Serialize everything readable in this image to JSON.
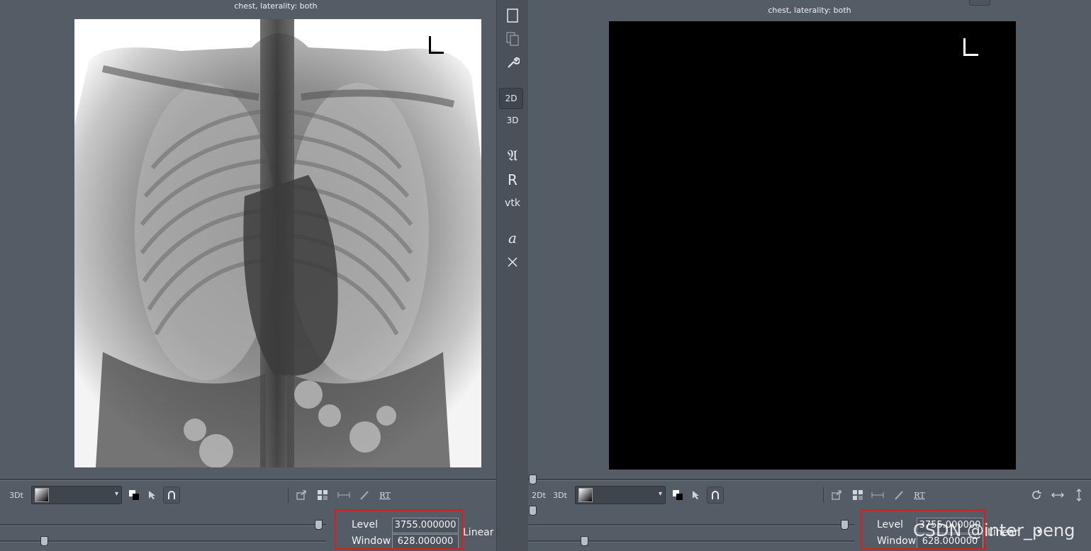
{
  "left_view": {
    "caption": "chest, laterality: both",
    "orientation_marker": "L",
    "toolbar": {
      "mode_3dt": "3Dt"
    },
    "level_label": "Level",
    "level_value": "3755.000000",
    "window_label": "Window",
    "window_value": "628.000000",
    "interpolation": "Linear"
  },
  "right_view": {
    "caption": "chest, laterality: both",
    "orientation_marker": "L",
    "toolbar": {
      "mode_2dt": "2Dt",
      "mode_3dt": "3Dt"
    },
    "level_label": "Level",
    "level_value": "3755.000000",
    "window_label": "Window",
    "window_value": "628.000000",
    "interpolation": "Linear"
  },
  "vertical_toolbar": {
    "mode_2d": "2D",
    "mode_3d": "3D",
    "renderer_r": "R",
    "renderer_vtk": "vtk",
    "font_a": "a"
  },
  "watermark": "CSDN @inter_peng",
  "colors": {
    "highlight_box": "#e01b1b",
    "panel_bg": "#545c66"
  }
}
